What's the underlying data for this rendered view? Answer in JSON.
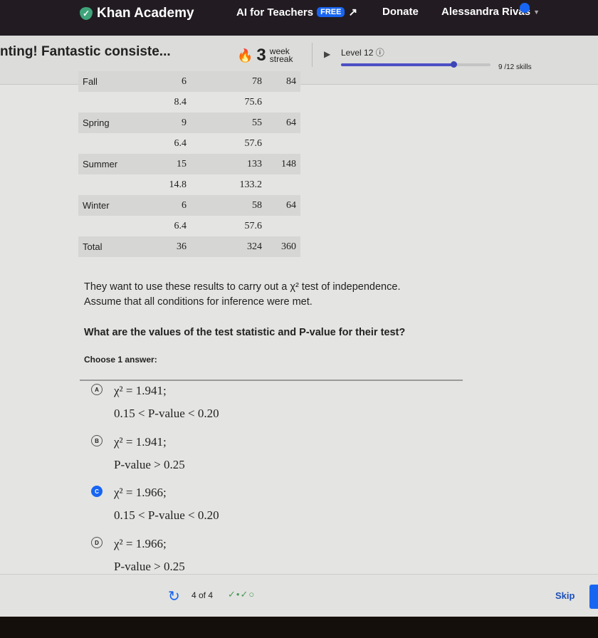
{
  "header": {
    "brand": "Khan Academy",
    "ai_for_teachers": "AI for Teachers",
    "free_badge": "FREE",
    "donate": "Donate",
    "user": "Alessandra Rivas"
  },
  "subbar": {
    "goal_text": "nting! Fantastic consiste...",
    "streak_num": "3",
    "streak_label1": "week",
    "streak_label2": "streak",
    "level": "Level 12 ⓘ",
    "skills": "9 /12 skills",
    "progress_fraction": 0.75
  },
  "table": {
    "rows": [
      {
        "label": "Fall",
        "c1": "6",
        "c2": "78",
        "c3": "84",
        "observed": true
      },
      {
        "label": "",
        "c1": "8.4",
        "c2": "75.6",
        "c3": "",
        "observed": false
      },
      {
        "label": "Spring",
        "c1": "9",
        "c2": "55",
        "c3": "64",
        "observed": true
      },
      {
        "label": "",
        "c1": "6.4",
        "c2": "57.6",
        "c3": "",
        "observed": false
      },
      {
        "label": "Summer",
        "c1": "15",
        "c2": "133",
        "c3": "148",
        "observed": true
      },
      {
        "label": "",
        "c1": "14.8",
        "c2": "133.2",
        "c3": "",
        "observed": false
      },
      {
        "label": "Winter",
        "c1": "6",
        "c2": "58",
        "c3": "64",
        "observed": true
      },
      {
        "label": "",
        "c1": "6.4",
        "c2": "57.6",
        "c3": "",
        "observed": false
      },
      {
        "label": "Total",
        "c1": "36",
        "c2": "324",
        "c3": "360",
        "observed": true
      }
    ]
  },
  "question": {
    "line1": "They want to use these results to carry out a χ² test of independence.",
    "line2": "Assume that all conditions for inference were met.",
    "line3": "What are the values of the test statistic and P-value for their test?",
    "prompt": "Choose 1 answer:"
  },
  "choices": [
    {
      "letter": "A",
      "stat": "χ² = 1.941;",
      "pvalue": "0.15 < P-value < 0.20",
      "selected": false
    },
    {
      "letter": "B",
      "stat": "χ² = 1.941;",
      "pvalue": "P-value > 0.25",
      "selected": false
    },
    {
      "letter": "C",
      "stat": "χ² = 1.966;",
      "pvalue": "0.15 < P-value < 0.20",
      "selected": true
    },
    {
      "letter": "D",
      "stat": "χ² = 1.966;",
      "pvalue": "P-value > 0.25",
      "selected": false
    }
  ],
  "footer": {
    "count": "4 of 4",
    "progress_marks": "✓•✓○",
    "skip": "Skip"
  },
  "colors": {
    "accent": "#1865f2",
    "header_bg": "#221c22",
    "progress": "#4b4fc4"
  }
}
